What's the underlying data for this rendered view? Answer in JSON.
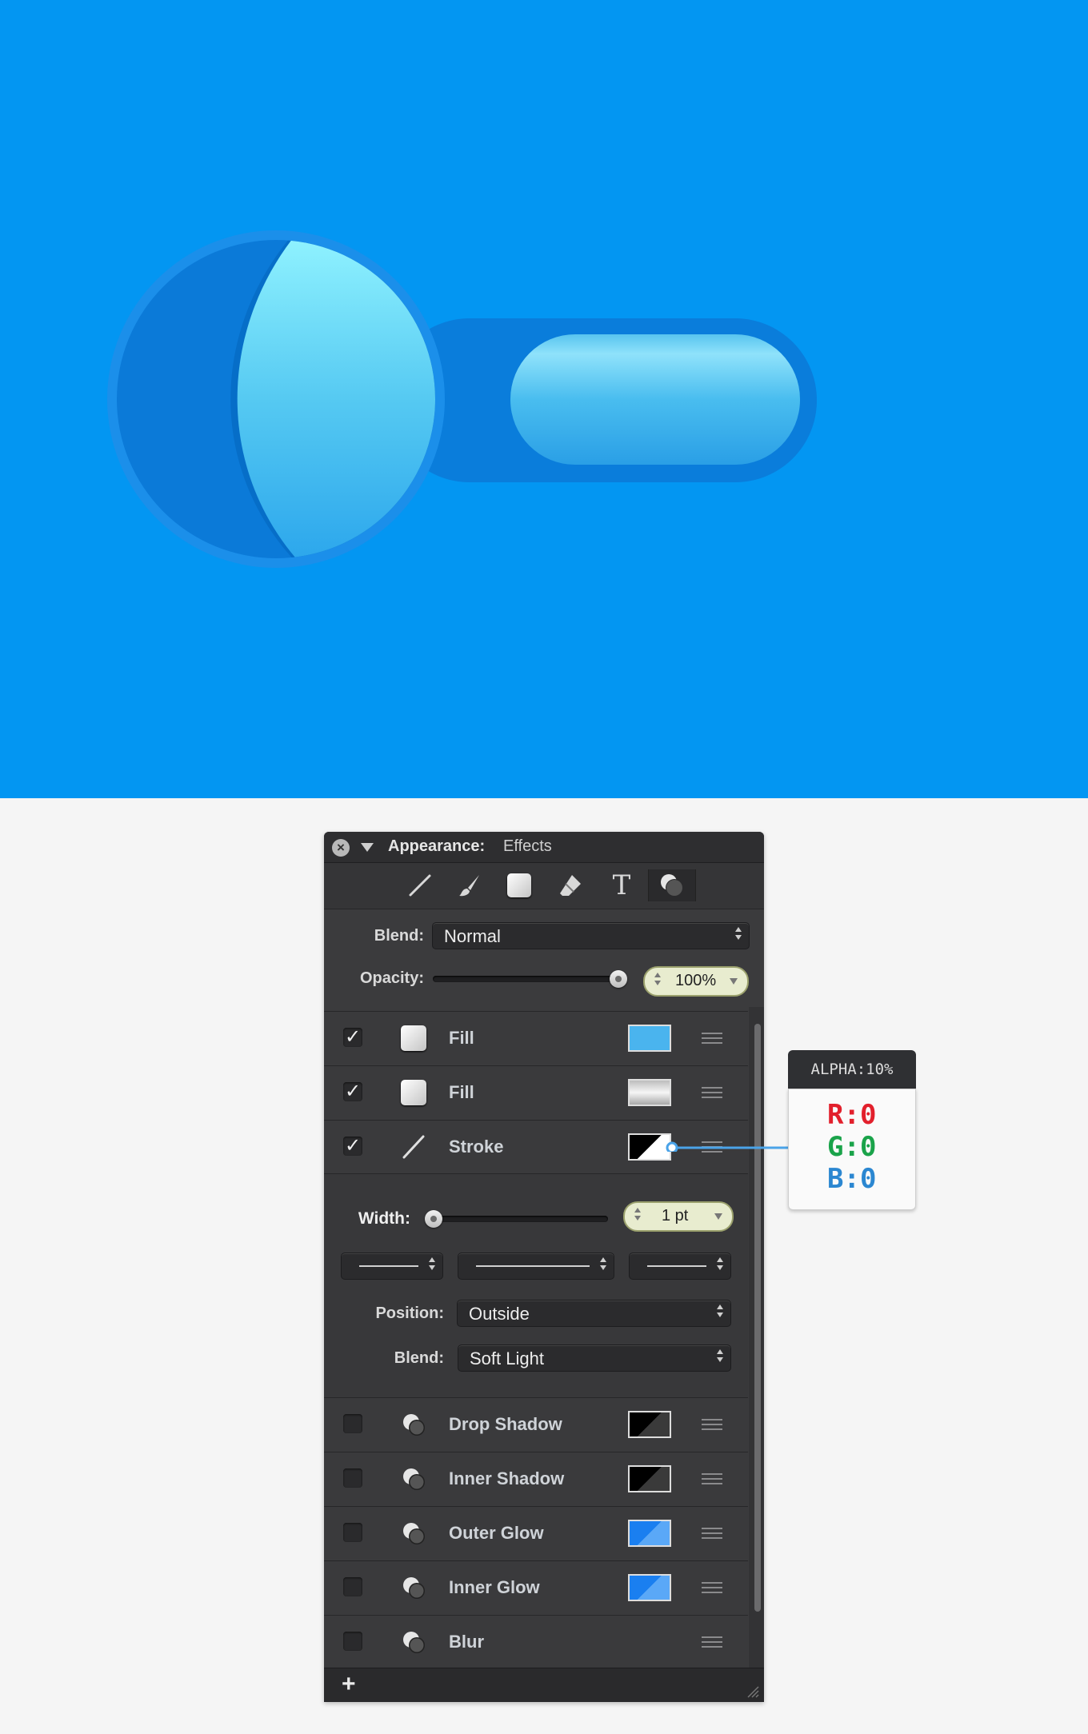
{
  "panel": {
    "title_label": "Appearance:",
    "title_value": "Effects",
    "tools": [
      "stroke-tool-icon",
      "brush-tool-icon",
      "fill-tool-icon",
      "eraser-tool-icon",
      "text-tool-icon",
      "effects-tool-icon"
    ],
    "blend_label": "Blend:",
    "blend_value": "Normal",
    "opacity_label": "Opacity:",
    "opacity_value": "100%",
    "opacity_level": 1.0,
    "layers": [
      {
        "checked": true,
        "icon": "fill-icon",
        "label": "Fill",
        "swatch": "#4ab4ee",
        "swatch_kind": "solid"
      },
      {
        "checked": true,
        "icon": "fill-icon",
        "label": "Fill",
        "swatch": "gradient",
        "swatch_kind": "gradient"
      },
      {
        "checked": true,
        "icon": "stroke-icon",
        "label": "Stroke",
        "swatch": "black-white",
        "swatch_kind": "split"
      }
    ],
    "stroke_settings": {
      "width_label": "Width:",
      "width_value": "1 pt",
      "width_level": 0.0,
      "position_label": "Position:",
      "position_value": "Outside",
      "blend_label": "Blend:",
      "blend_value": "Soft Light"
    },
    "effects": [
      {
        "checked": false,
        "label": "Drop Shadow",
        "swatch_colors": [
          "#000000",
          "#3a3a3a"
        ]
      },
      {
        "checked": false,
        "label": "Inner Shadow",
        "swatch_colors": [
          "#000000",
          "#3a3a3a"
        ]
      },
      {
        "checked": false,
        "label": "Outer Glow",
        "swatch_colors": [
          "#1a7ff0",
          "#5aa8f7"
        ]
      },
      {
        "checked": false,
        "label": "Inner Glow",
        "swatch_colors": [
          "#1a7ff0",
          "#5aa8f7"
        ]
      },
      {
        "checked": false,
        "label": "Blur",
        "swatch_colors": null
      }
    ],
    "add_label": "+"
  },
  "tooltip": {
    "header": "ALPHA:10%",
    "r": "R:0",
    "g": "G:0",
    "b": "B:0",
    "r_color": "#e2202c",
    "g_color": "#1aa34a",
    "b_color": "#2b87d1"
  },
  "colors": {
    "canvas_bg": "#0396f2",
    "panel_bg": "#3b3b3d"
  }
}
